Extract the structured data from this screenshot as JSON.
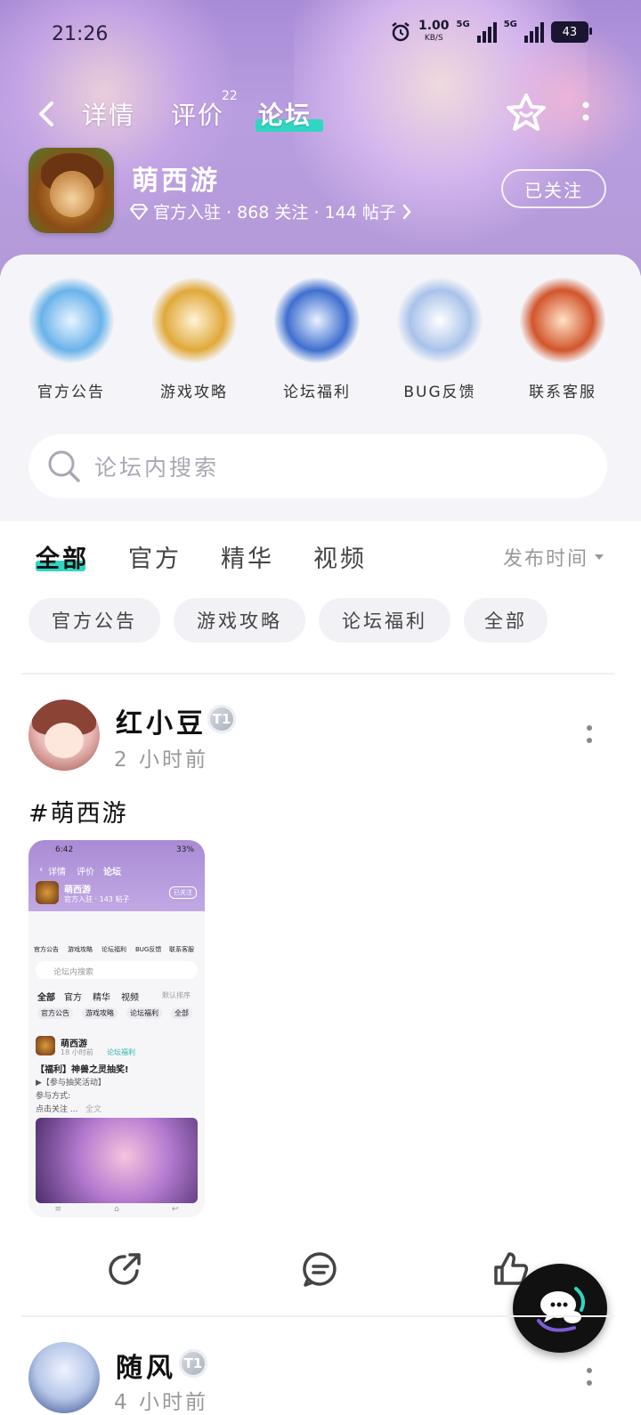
{
  "status_bar": {
    "time": "21:26",
    "net_speed": "1.00",
    "net_unit": "KB/S",
    "sim1": "5G",
    "sim2": "5G",
    "battery": "43"
  },
  "nav": {
    "tabs": [
      {
        "label": "详情"
      },
      {
        "label": "评价"
      },
      {
        "label": "论坛"
      }
    ],
    "active_tab": "论坛",
    "review_count": "22"
  },
  "app": {
    "name": "萌西游",
    "meta": "官方入驻 · 868 关注 · 144 帖子",
    "follow_label": "已关注"
  },
  "categories": [
    {
      "label": "官方公告"
    },
    {
      "label": "游戏攻略"
    },
    {
      "label": "论坛福利"
    },
    {
      "label": "BUG反馈"
    },
    {
      "label": "联系客服"
    }
  ],
  "search": {
    "placeholder": "论坛内搜索"
  },
  "filter_tabs": [
    {
      "label": "全部"
    },
    {
      "label": "官方"
    },
    {
      "label": "精华"
    },
    {
      "label": "视频"
    }
  ],
  "sort_label": "发布时间",
  "chips": [
    {
      "label": "官方公告"
    },
    {
      "label": "游戏攻略"
    },
    {
      "label": "论坛福利"
    },
    {
      "label": "全部"
    }
  ],
  "posts": [
    {
      "user": "红小豆",
      "level": "T1",
      "time": "2 小时前",
      "text": "#萌西游",
      "thumb": {
        "time": "6:42",
        "battery": "33%",
        "tabs": [
          "详情",
          "评价",
          "论坛"
        ],
        "app_name": "萌西游",
        "app_meta": "官方入驻 · 143 帖子",
        "follow": "已关注",
        "cats": [
          "官方公告",
          "游戏攻略",
          "论坛福利",
          "BUG反馈",
          "联系客服"
        ],
        "search": "论坛内搜索",
        "filters": [
          "全部",
          "官方",
          "精华",
          "视频"
        ],
        "sort": "默认排序",
        "chips": [
          "官方公告",
          "游戏攻略",
          "论坛福利",
          "全部"
        ],
        "post_user": "萌西游",
        "post_time": "18 小时前",
        "post_tag": "论坛福利",
        "post_title": "【福利】神兽之灵抽奖!",
        "post_line1": "▶【参与抽奖活动】",
        "post_line2": "参与方式:",
        "post_line3": "点击关注 ...",
        "post_more": "全文"
      }
    },
    {
      "user": "随风",
      "level": "T1",
      "time": "4 小时前"
    }
  ],
  "colors": {
    "accent": "#2fd6c2",
    "header": "#b49ad8"
  }
}
